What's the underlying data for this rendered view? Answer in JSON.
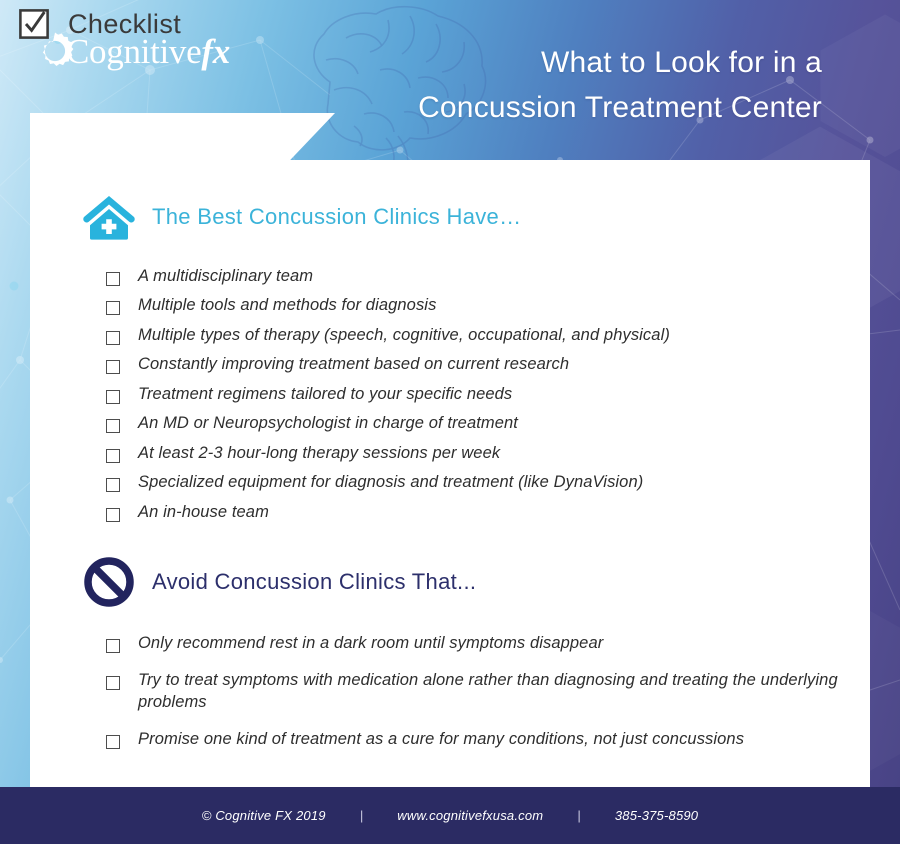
{
  "header": {
    "logo_text": "Cognitive",
    "logo_accent": "fx",
    "logo_icon": "gear-icon",
    "title_line1": "What to Look for in a",
    "title_line2": "Concussion Treatment Center",
    "brain_watermark": "brain-illustration"
  },
  "tab": {
    "label": "Checklist",
    "icon": "checked-checkbox-icon"
  },
  "sections": [
    {
      "icon": "clinic-house-plus-icon",
      "title": "The Best Concussion Clinics Have…",
      "title_color": "#3bb3d9",
      "items": [
        "A multidisciplinary team",
        "Multiple tools and methods for diagnosis",
        "Multiple types of therapy (speech, cognitive, occupational, and physical)",
        "Constantly improving treatment based on current research",
        "Treatment regimens tailored to your specific needs",
        "An MD or Neuropsychologist in charge of treatment",
        "At least 2-3 hour-long therapy sessions per week",
        "Specialized equipment for diagnosis and treatment (like DynaVision)",
        "An in-house team"
      ]
    },
    {
      "icon": "prohibited-sign-icon",
      "title": "Avoid Concussion Clinics That...",
      "title_color": "#2c2f6b",
      "items": [
        "Only recommend rest in a dark room until symptoms disappear",
        "Try to treat symptoms with medication alone rather than diagnosing and treating the underlying problems",
        "Promise one kind of treatment as a cure for many conditions, not just concussions"
      ]
    }
  ],
  "footer": {
    "copyright": "© Cognitive FX 2019",
    "separator1": "|",
    "website": "www.cognitivefxusa.com",
    "separator2": "|",
    "phone": "385-375-8590"
  },
  "colors": {
    "gradient_start": "#cfe9f7",
    "gradient_end": "#474283",
    "accent_teal": "#3bb3d9",
    "navy": "#2b2b63",
    "card_bg": "#ffffff"
  }
}
